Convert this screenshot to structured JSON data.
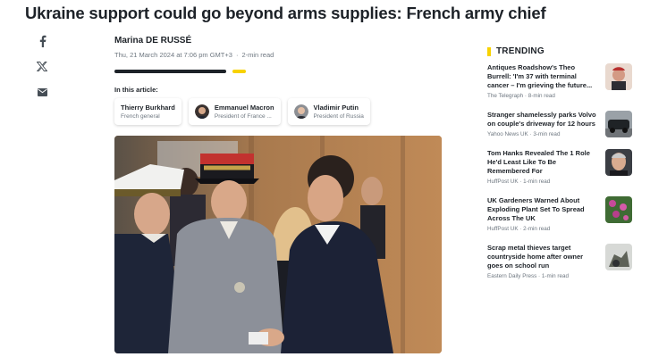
{
  "article": {
    "headline": "Ukraine support could go beyond arms supplies: French army chief",
    "author": "Marina DE RUSSÉ",
    "date": "Thu, 21 March 2024 at 7:06 pm GMT+3",
    "separator": "·",
    "read_time": "2-min read",
    "in_article_label": "In this article:",
    "people": [
      {
        "name": "Thierry Burkhard",
        "role": "French general"
      },
      {
        "name": "Emmanuel Macron",
        "role": "President of France ..."
      },
      {
        "name": "Vladimir Putin",
        "role": "President of Russia"
      }
    ],
    "reading_progress": 0.85
  },
  "share": {
    "icons": [
      "facebook-icon",
      "x-icon",
      "mail-icon"
    ]
  },
  "trending": {
    "label": "TRENDING",
    "accent_color": "#f8d200",
    "items": [
      {
        "title": "Antiques Roadshow's Theo Burrell: 'I'm 37 with terminal cancer – I'm grieving the future...",
        "source": "The Telegraph",
        "time": "8-min read"
      },
      {
        "title": "Stranger shamelessly parks Volvo on couple's driveway for 12 hours",
        "source": "Yahoo News UK",
        "time": "3-min read"
      },
      {
        "title": "Tom Hanks Revealed The 1 Role He'd Least Like To Be Remembered For",
        "source": "HuffPost UK",
        "time": "1-min read"
      },
      {
        "title": "UK Gardeners Warned About Exploding Plant Set To Spread Across The UK",
        "source": "HuffPost UK",
        "time": "2-min read"
      },
      {
        "title": "Scrap metal thieves target countryside home after owner goes on school run",
        "source": "Eastern Daily Press",
        "time": "1-min read"
      }
    ]
  }
}
